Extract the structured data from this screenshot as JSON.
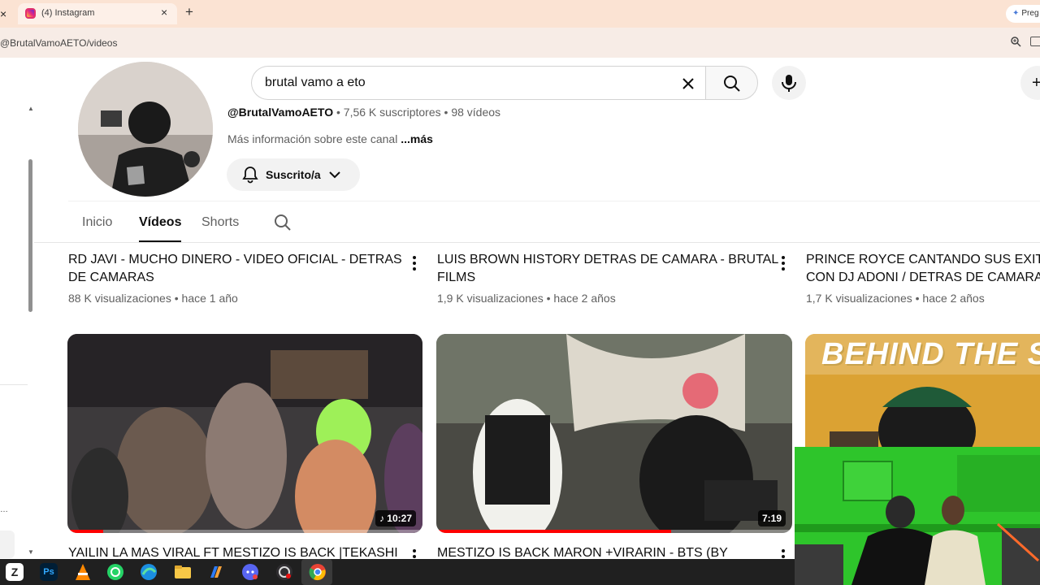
{
  "browser": {
    "tab_title": "(4) Instagram",
    "tab_close": "×",
    "new_tab": "+",
    "left_close": "×",
    "ask_button": "Preg",
    "url": "@BrutalVamoAETO/videos"
  },
  "header": {
    "search_value": "brutal vamo a eto",
    "create_label": "+"
  },
  "channel": {
    "handle": "@BrutalVamoAETO",
    "subscribers": "7,56 K suscriptores",
    "video_count": "98 vídeos",
    "separator": "•",
    "description": "Más información sobre este canal",
    "more": "...más",
    "subscribe_label": "Suscrito/a"
  },
  "tabs": [
    {
      "label": "Inicio"
    },
    {
      "label": "Vídeos"
    },
    {
      "label": "Shorts"
    }
  ],
  "videos_row1": [
    {
      "title_line1": "RD JAVI - MUCHO DINERO - VIDEO OFICIAL - DETRAS",
      "title_line2": "DE CAMARAS",
      "meta": "88 K visualizaciones • hace 1 año"
    },
    {
      "title_line1": "LUIS BROWN HISTORY DETRAS DE CAMARA - BRUTAL",
      "title_line2": "FILMS",
      "meta": "1,9 K visualizaciones • hace 2 años"
    },
    {
      "title_line1": "PRINCE ROYCE CANTANDO SUS EXITO",
      "title_line2": "CON DJ ADONI / DETRAS DE CAMARA",
      "meta": "1,7 K visualizaciones • hace 2 años"
    }
  ],
  "videos_row2": [
    {
      "duration": "♪ 10:27",
      "progress": 0.1,
      "title": "YAILIN LA MAS VIRAL FT MESTIZO IS BACK |TEKASHI"
    },
    {
      "duration": "7:19",
      "progress": 0.66,
      "title": "MESTIZO IS BACK MARON +VIRARIN - BTS   (BY"
    },
    {
      "overlay_text": "BEHIND THE S"
    }
  ],
  "colors": {
    "accent_red": "#ff0000",
    "webcam_green": "#2ec52b",
    "tabbar": "#fbe3d3"
  },
  "taskbar_icons": [
    "zotero-icon",
    "photoshop-icon",
    "vlc-icon",
    "whatsapp-icon",
    "edge-icon",
    "file-explorer-icon",
    "copilot-icon",
    "discord-icon",
    "obs-icon",
    "chrome-icon"
  ],
  "taskbar_labels": {
    "photoshop": "Ps"
  }
}
